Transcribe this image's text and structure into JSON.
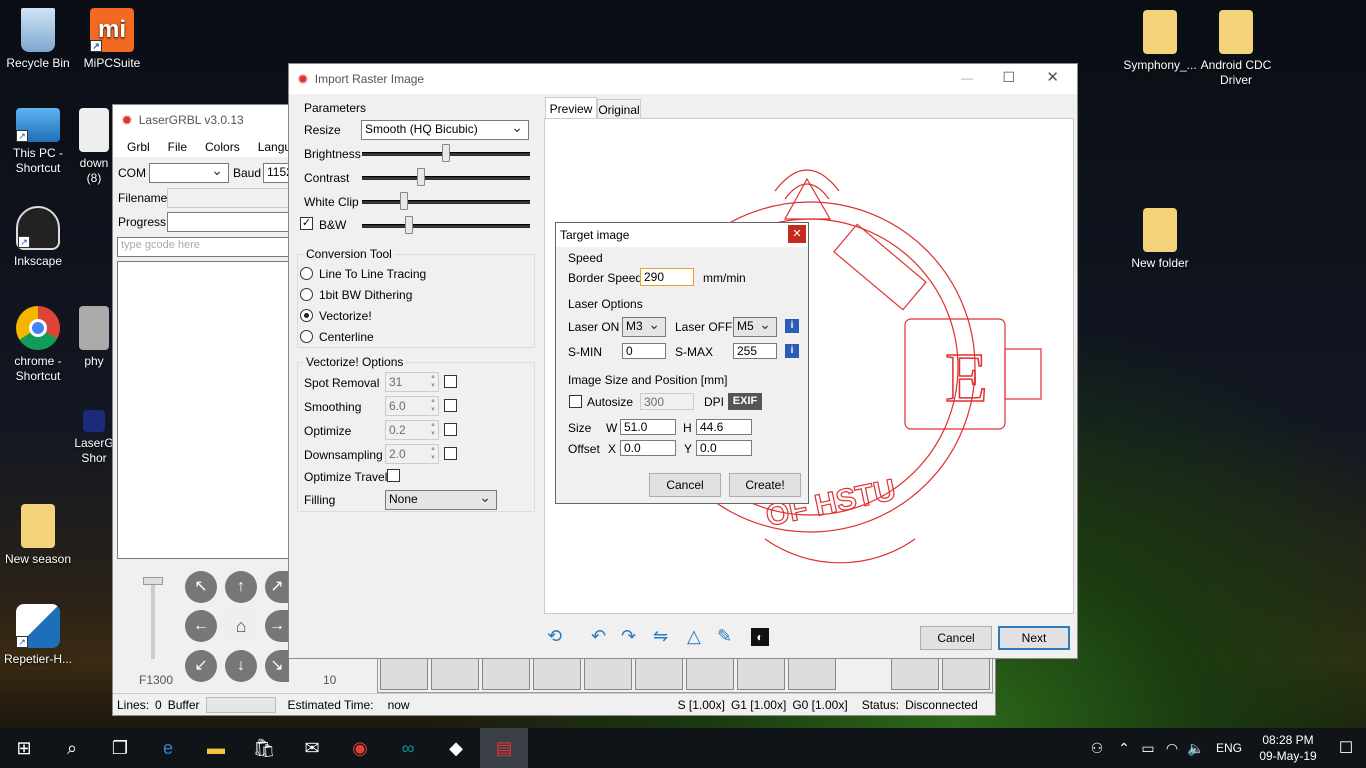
{
  "desktop": {
    "icons": [
      {
        "label": "Recycle Bin"
      },
      {
        "label": "MiPCSuite"
      },
      {
        "label": "This PC - Shortcut"
      },
      {
        "label": "down (8)"
      },
      {
        "label": "Inkscape"
      },
      {
        "label": "chrome - Shortcut"
      },
      {
        "label": "phy"
      },
      {
        "label": "LaserG Shor"
      },
      {
        "label": "New season"
      },
      {
        "label": "Repetier-H..."
      },
      {
        "label": "Symphony_..."
      },
      {
        "label": "Android CDC Driver"
      },
      {
        "label": "New folder"
      }
    ]
  },
  "lasergrbl": {
    "title": "LaserGRBL v3.0.13",
    "menu": [
      "Grbl",
      "File",
      "Colors",
      "Langu"
    ],
    "com_label": "COM",
    "baud_label": "Baud",
    "baud_value": "1152",
    "filename_label": "Filename",
    "progress_label": "Progress",
    "gcode_placeholder": "type gcode here",
    "speed_label": "F1300",
    "scale_label": "10",
    "status": {
      "lines_label": "Lines:",
      "lines_value": "0",
      "buffer_label": "Buffer",
      "est_time_label": "Estimated Time:",
      "est_time_value": "now",
      "s": "S [1.00x]",
      "g1": "G1 [1.00x]",
      "g0": "G0 [1.00x]",
      "status_label": "Status:",
      "status_value": "Disconnected"
    }
  },
  "import": {
    "title": "Import Raster Image",
    "parameters_label": "Parameters",
    "resize_label": "Resize",
    "resize_value": "Smooth (HQ Bicubic)",
    "brightness_label": "Brightness",
    "contrast_label": "Contrast",
    "whiteclip_label": "White Clip",
    "bw_label": "B&W",
    "sliders": {
      "brightness": 0.5,
      "contrast": 0.35,
      "whiteclip": 0.25,
      "bw": 0.28
    },
    "conversion_label": "Conversion Tool",
    "tools": [
      "Line To Line Tracing",
      "1bit BW Dithering",
      "Vectorize!",
      "Centerline"
    ],
    "vector_options_label": "Vectorize! Options",
    "spot_removal_label": "Spot Removal",
    "spot_removal_value": "31",
    "smoothing_label": "Smoothing",
    "smoothing_value": "6.0",
    "optimize_label": "Optimize",
    "optimize_value": "0.2",
    "downsampling_label": "Downsampling",
    "downsampling_value": "2.0",
    "optimize_travel_label": "Optimize Travel",
    "filling_label": "Filling",
    "filling_value": "None",
    "tab_preview": "Preview",
    "tab_original": "Original",
    "cancel": "Cancel",
    "next": "Next",
    "preview_text_e": "E",
    "preview_text_hstu": "OF HSTU"
  },
  "target": {
    "title": "Target image",
    "speed_label": "Speed",
    "border_speed_label": "Border Speed",
    "border_speed_value": "290",
    "speed_unit": "mm/min",
    "laser_options_label": "Laser Options",
    "laser_on_label": "Laser ON",
    "laser_on_value": "M3",
    "laser_off_label": "Laser OFF",
    "laser_off_value": "M5",
    "smin_label": "S-MIN",
    "smin_value": "0",
    "smax_label": "S-MAX",
    "smax_value": "255",
    "image_size_label": "Image Size and Position [mm]",
    "autosize_label": "Autosize",
    "dpi_value": "300",
    "dpi_label": "DPI",
    "exif_label": "EXIF",
    "size_label": "Size",
    "w_label": "W",
    "w_value": "51.0",
    "h_label": "H",
    "h_value": "44.6",
    "offset_label": "Offset",
    "x_label": "X",
    "x_value": "0.0",
    "y_label": "Y",
    "y_value": "0.0",
    "cancel": "Cancel",
    "create": "Create!"
  },
  "taskbar": {
    "lang": "ENG",
    "time": "08:28 PM",
    "date": "09-May-19"
  }
}
